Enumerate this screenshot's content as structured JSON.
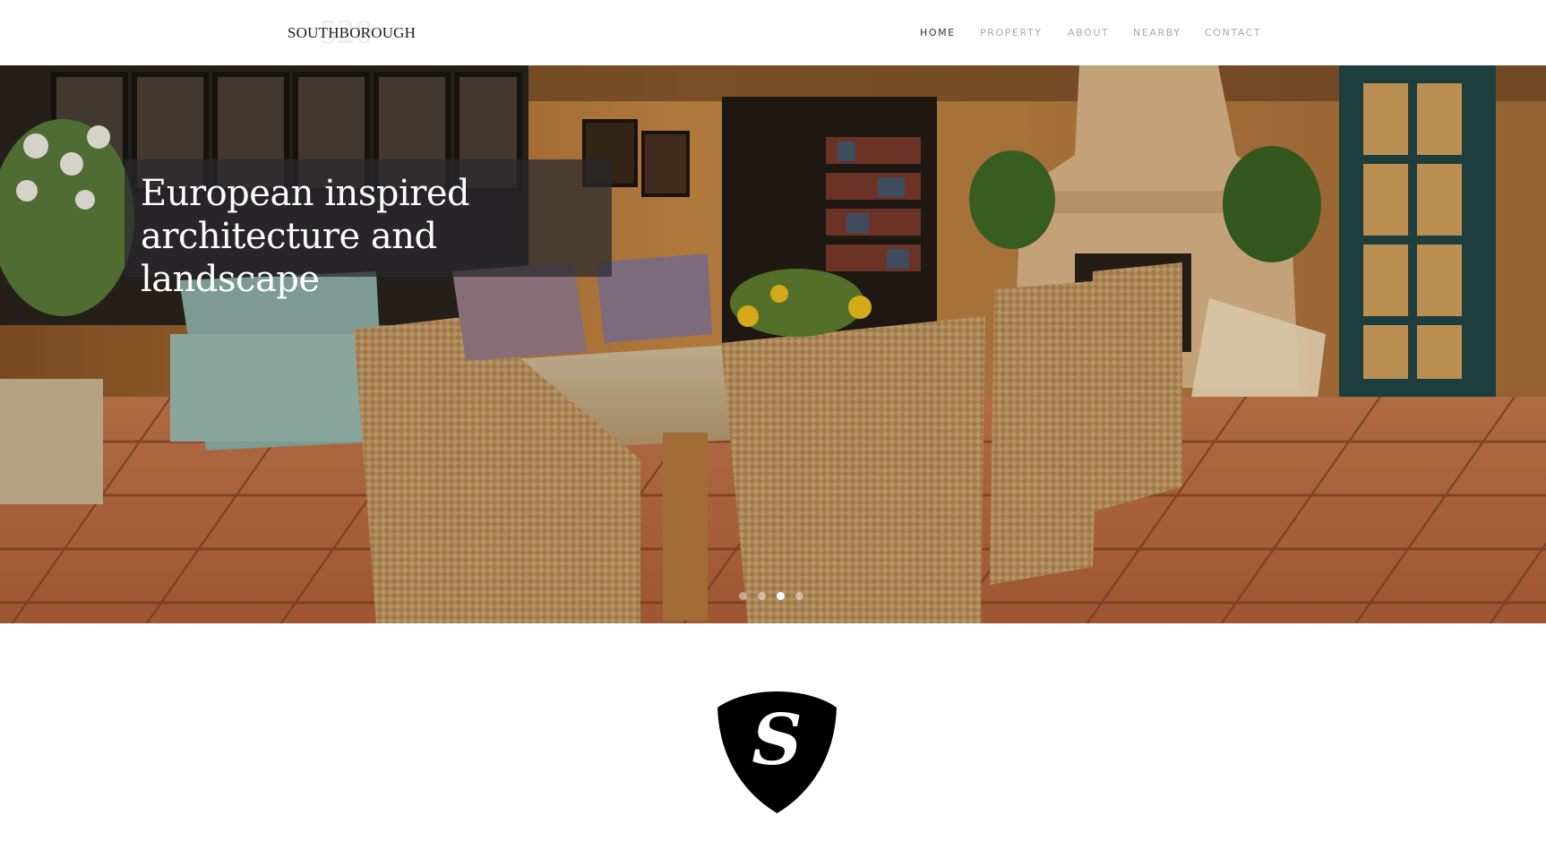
{
  "header": {
    "logo": {
      "number": "520",
      "name": "SOUTHBOROUGH"
    },
    "nav": [
      {
        "label": "HOME",
        "active": true
      },
      {
        "label": "PROPERTY",
        "active": false
      },
      {
        "label": "ABOUT",
        "active": false
      },
      {
        "label": "NEARBY",
        "active": false
      },
      {
        "label": "CONTACT",
        "active": false
      }
    ]
  },
  "hero": {
    "caption_line1": "European inspired",
    "caption_line2": "architecture and landscape",
    "slide_count": 4,
    "active_slide": 3
  },
  "crest": {
    "letter": "S"
  },
  "colors": {
    "nav_active": "#333333",
    "nav_inactive": "#a9a9a9",
    "caption_bg": "#28282e",
    "crest": "#000000"
  }
}
